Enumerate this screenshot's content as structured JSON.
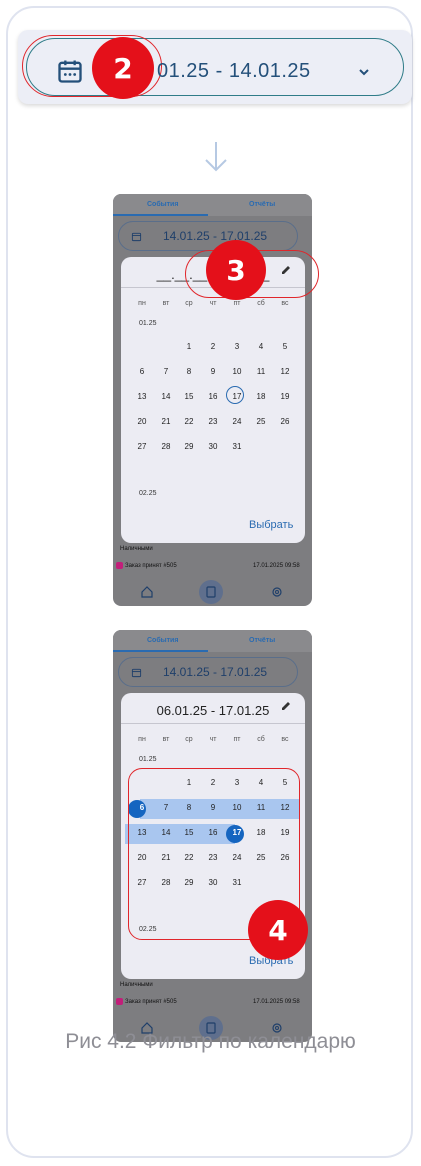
{
  "top_bar": {
    "date_range": "01.25 - 14.01.25",
    "badge": "2"
  },
  "screen1": {
    "tab_events": "События",
    "tab_reports": "Отчёты",
    "date_range": "14.01.25 - 17.01.25",
    "header_placeholder": "__.__.__ - __.__.__",
    "badge": "3",
    "weekdays": [
      "пн",
      "вт",
      "ср",
      "чт",
      "пт",
      "сб",
      "вс"
    ],
    "month1": "01.25",
    "month2": "02.25",
    "rows": [
      [
        "",
        "",
        "1",
        "2",
        "3",
        "4",
        "5"
      ],
      [
        "6",
        "7",
        "8",
        "9",
        "10",
        "11",
        "12"
      ],
      [
        "13",
        "14",
        "15",
        "16",
        "17",
        "18",
        "19"
      ],
      [
        "20",
        "21",
        "22",
        "23",
        "24",
        "25",
        "26"
      ],
      [
        "27",
        "28",
        "29",
        "30",
        "31",
        "",
        ""
      ]
    ],
    "choose_label": "Выбрать",
    "cash_label": "Наличными",
    "order_text": "Заказ принят #505",
    "order_time": "17.01.2025 09:58"
  },
  "screen2": {
    "tab_events": "События",
    "tab_reports": "Отчёты",
    "date_range": "14.01.25 - 17.01.25",
    "header_range": "06.01.25  -  17.01.25",
    "badge": "4",
    "weekdays": [
      "пн",
      "вт",
      "ср",
      "чт",
      "пт",
      "сб",
      "вс"
    ],
    "month1": "01.25",
    "month2": "02.25",
    "rows": [
      [
        "",
        "",
        "1",
        "2",
        "3",
        "4",
        "5"
      ],
      [
        "6",
        "7",
        "8",
        "9",
        "10",
        "11",
        "12"
      ],
      [
        "13",
        "14",
        "15",
        "16",
        "17",
        "18",
        "19"
      ],
      [
        "20",
        "21",
        "22",
        "23",
        "24",
        "25",
        "26"
      ],
      [
        "27",
        "28",
        "29",
        "30",
        "31",
        "",
        ""
      ]
    ],
    "choose_label": "Выбрать",
    "cash_label": "Наличными",
    "order_text": "Заказ принят #505",
    "order_time": "17.01.2025 09:58"
  },
  "caption": "Рис 4.2 Фильтр по календарю",
  "colors": {
    "accent": "#2a6bb1",
    "badge": "#e4101a",
    "range": "#a9c6ef"
  }
}
